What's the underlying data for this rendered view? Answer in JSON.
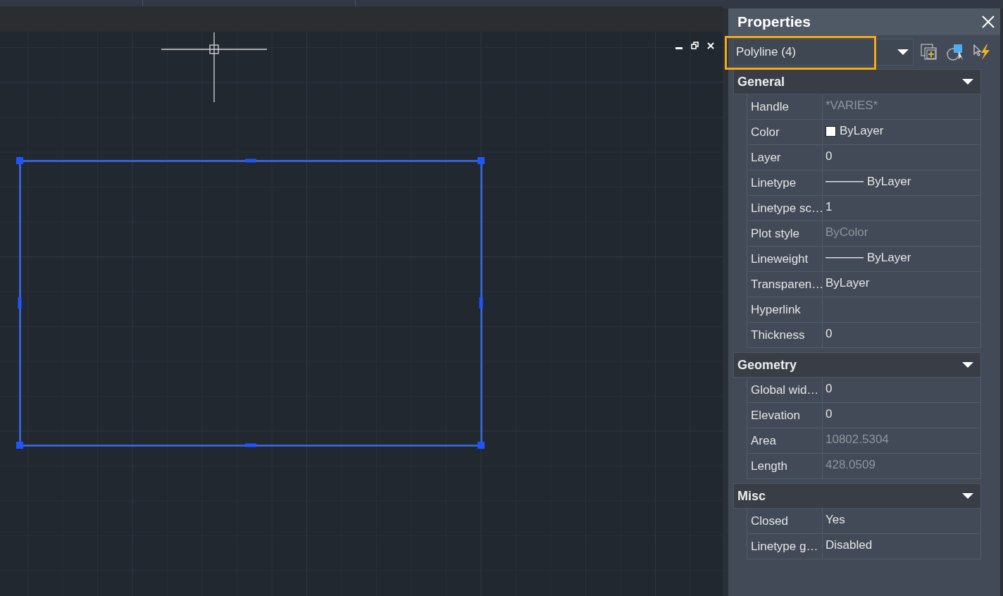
{
  "panel": {
    "title": "Properties",
    "selection": {
      "value": "Polyline (4)",
      "highlighted": true
    },
    "sections": [
      {
        "title": "General",
        "expanded": true,
        "rows": [
          {
            "label": "Handle",
            "value": "*VARIES*",
            "kind": "text",
            "readonly": true
          },
          {
            "label": "Color",
            "value": "ByLayer",
            "kind": "swatch",
            "color": "#ffffff",
            "readonly": false
          },
          {
            "label": "Layer",
            "value": "0",
            "kind": "text",
            "readonly": false
          },
          {
            "label": "Linetype",
            "value": "ByLayer",
            "kind": "line",
            "readonly": false
          },
          {
            "label": "Linetype sc…",
            "value": "1",
            "kind": "text",
            "readonly": false
          },
          {
            "label": "Plot style",
            "value": "ByColor",
            "kind": "text",
            "readonly": true
          },
          {
            "label": "Lineweight",
            "value": "ByLayer",
            "kind": "line",
            "readonly": false
          },
          {
            "label": "Transparen…",
            "value": "ByLayer",
            "kind": "text",
            "readonly": false
          },
          {
            "label": "Hyperlink",
            "kind": "text",
            "readonly": false
          },
          {
            "label": "Thickness",
            "value": "0",
            "kind": "text",
            "readonly": false
          }
        ]
      },
      {
        "title": "Geometry",
        "expanded": true,
        "rows": [
          {
            "label": "Global wid…",
            "value": "0",
            "kind": "text",
            "readonly": false
          },
          {
            "label": "Elevation",
            "value": "0",
            "kind": "text",
            "readonly": false
          },
          {
            "label": "Area",
            "value": "10802.5304",
            "kind": "text",
            "readonly": true
          },
          {
            "label": "Length",
            "value": "428.0509",
            "kind": "text",
            "readonly": true
          }
        ]
      },
      {
        "title": "Misc",
        "expanded": true,
        "rows": [
          {
            "label": "Closed",
            "value": "Yes",
            "kind": "text",
            "readonly": false
          },
          {
            "label": "Linetype g…",
            "value": "Disabled",
            "kind": "text",
            "readonly": false
          }
        ]
      }
    ]
  }
}
